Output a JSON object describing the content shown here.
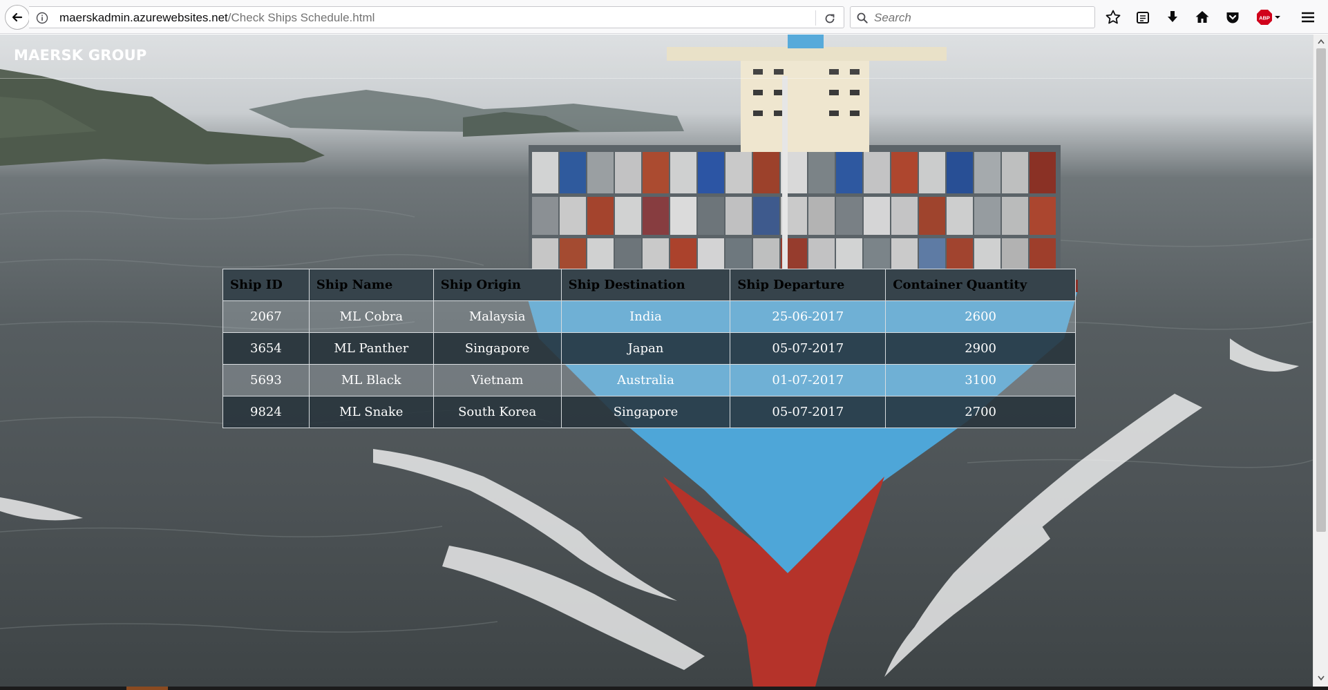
{
  "browser": {
    "url_domain": "maerskadmin.azurewebsites.net",
    "url_path": "/Check Ships Schedule.html",
    "search_placeholder": "Search",
    "abp_label": "ABP"
  },
  "site": {
    "brand": "MAERSK GROUP"
  },
  "table": {
    "headers": [
      "Ship ID",
      "Ship Name",
      "Ship Origin",
      "Ship Destination",
      "Ship Departure",
      "Container Quantity"
    ],
    "rows": [
      [
        "2067",
        "ML Cobra",
        "Malaysia",
        "India",
        "25-06-2017",
        "2600"
      ],
      [
        "3654",
        "ML Panther",
        "Singapore",
        "Japan",
        "05-07-2017",
        "2900"
      ],
      [
        "5693",
        "ML Black",
        "Vietnam",
        "Australia",
        "01-07-2017",
        "3100"
      ],
      [
        "9824",
        "ML Snake",
        "South Korea",
        "Singapore",
        "05-07-2017",
        "2700"
      ]
    ]
  },
  "colors": {
    "header_bg": "#36434b",
    "even_row_bg": "#28343c",
    "hull_blue": "#4ea6d8",
    "hull_red": "#b5332a",
    "abp_red": "#d0021b"
  }
}
